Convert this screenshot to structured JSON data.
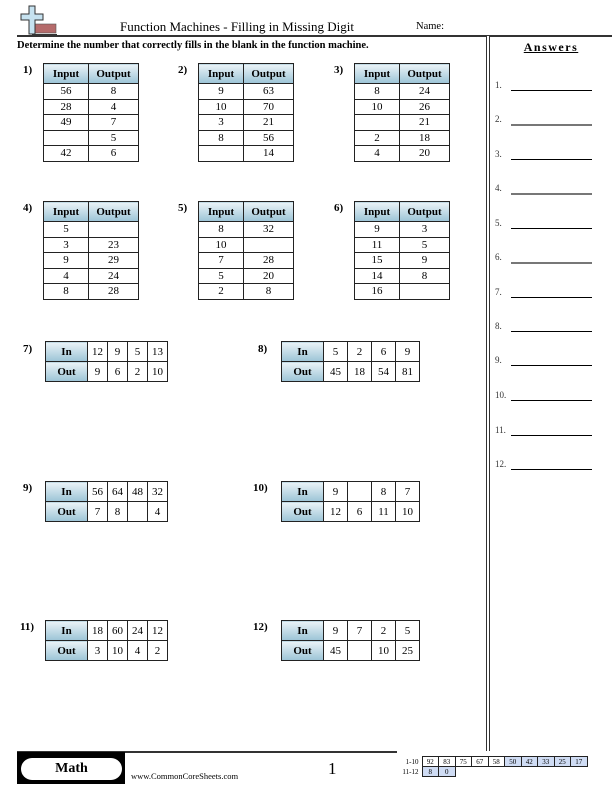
{
  "header": {
    "logo_icon": "plus-cross-logo-icon",
    "title": "Function Machines - Filling in Missing Digit",
    "name_label": "Name:",
    "instructions": "Determine the number that correctly fills in the blank in the function machine."
  },
  "answers": {
    "title": "Answers",
    "items": [
      "1.",
      "2.",
      "3.",
      "4.",
      "5.",
      "6.",
      "7.",
      "8.",
      "9.",
      "10.",
      "11.",
      "12."
    ]
  },
  "vertical_problems": {
    "col_input": "Input",
    "col_output": "Output",
    "items": [
      {
        "label": "1)",
        "rows": [
          [
            "56",
            "8"
          ],
          [
            "28",
            "4"
          ],
          [
            "49",
            "7"
          ],
          [
            "",
            "5"
          ],
          [
            "42",
            "6"
          ]
        ]
      },
      {
        "label": "2)",
        "rows": [
          [
            "9",
            "63"
          ],
          [
            "10",
            "70"
          ],
          [
            "3",
            "21"
          ],
          [
            "8",
            "56"
          ],
          [
            "",
            "14"
          ]
        ]
      },
      {
        "label": "3)",
        "rows": [
          [
            "8",
            "24"
          ],
          [
            "10",
            "26"
          ],
          [
            "",
            "21"
          ],
          [
            "2",
            "18"
          ],
          [
            "4",
            "20"
          ]
        ]
      },
      {
        "label": "4)",
        "rows": [
          [
            "5",
            ""
          ],
          [
            "3",
            "23"
          ],
          [
            "9",
            "29"
          ],
          [
            "4",
            "24"
          ],
          [
            "8",
            "28"
          ]
        ]
      },
      {
        "label": "5)",
        "rows": [
          [
            "8",
            "32"
          ],
          [
            "10",
            ""
          ],
          [
            "7",
            "28"
          ],
          [
            "5",
            "20"
          ],
          [
            "2",
            "8"
          ]
        ]
      },
      {
        "label": "6)",
        "rows": [
          [
            "9",
            "3"
          ],
          [
            "11",
            "5"
          ],
          [
            "15",
            "9"
          ],
          [
            "14",
            "8"
          ],
          [
            "16",
            ""
          ]
        ]
      }
    ]
  },
  "horizontal_problems": {
    "row_in": "In",
    "row_out": "Out",
    "items": [
      {
        "label": "7)",
        "in": [
          "12",
          "9",
          "5",
          "13"
        ],
        "out": [
          "9",
          "6",
          "2",
          "10"
        ]
      },
      {
        "label": "8)",
        "in": [
          "5",
          "2",
          "6",
          "9"
        ],
        "out": [
          "45",
          "18",
          "54",
          "81"
        ]
      },
      {
        "label": "9)",
        "in": [
          "56",
          "64",
          "48",
          "32"
        ],
        "out": [
          "7",
          "8",
          "",
          "4"
        ]
      },
      {
        "label": "10)",
        "in": [
          "9",
          "",
          "8",
          "7"
        ],
        "out": [
          "12",
          "6",
          "11",
          "10"
        ]
      },
      {
        "label": "11)",
        "in": [
          "18",
          "60",
          "24",
          "12"
        ],
        "out": [
          "3",
          "10",
          "4",
          "2"
        ]
      },
      {
        "label": "12)",
        "in": [
          "9",
          "7",
          "2",
          "5"
        ],
        "out": [
          "45",
          "",
          "10",
          "25"
        ]
      }
    ]
  },
  "footer": {
    "subject": "Math",
    "site": "www.CommonCoreSheets.com",
    "page": "1",
    "score_rows": [
      {
        "label": "1-10",
        "scores": [
          "92",
          "83",
          "75",
          "67",
          "58",
          "50",
          "42",
          "33",
          "25",
          "17"
        ]
      },
      {
        "label": "11-12",
        "scores": [
          "8",
          "0"
        ]
      }
    ]
  },
  "colors": {
    "header_cell_top": "#eaf3f7",
    "header_cell_bottom": "#9cc4d6",
    "score_highlight": "#cfdcf4",
    "logo_cross": "#c6e2f0",
    "logo_bar": "#b56b6b"
  }
}
